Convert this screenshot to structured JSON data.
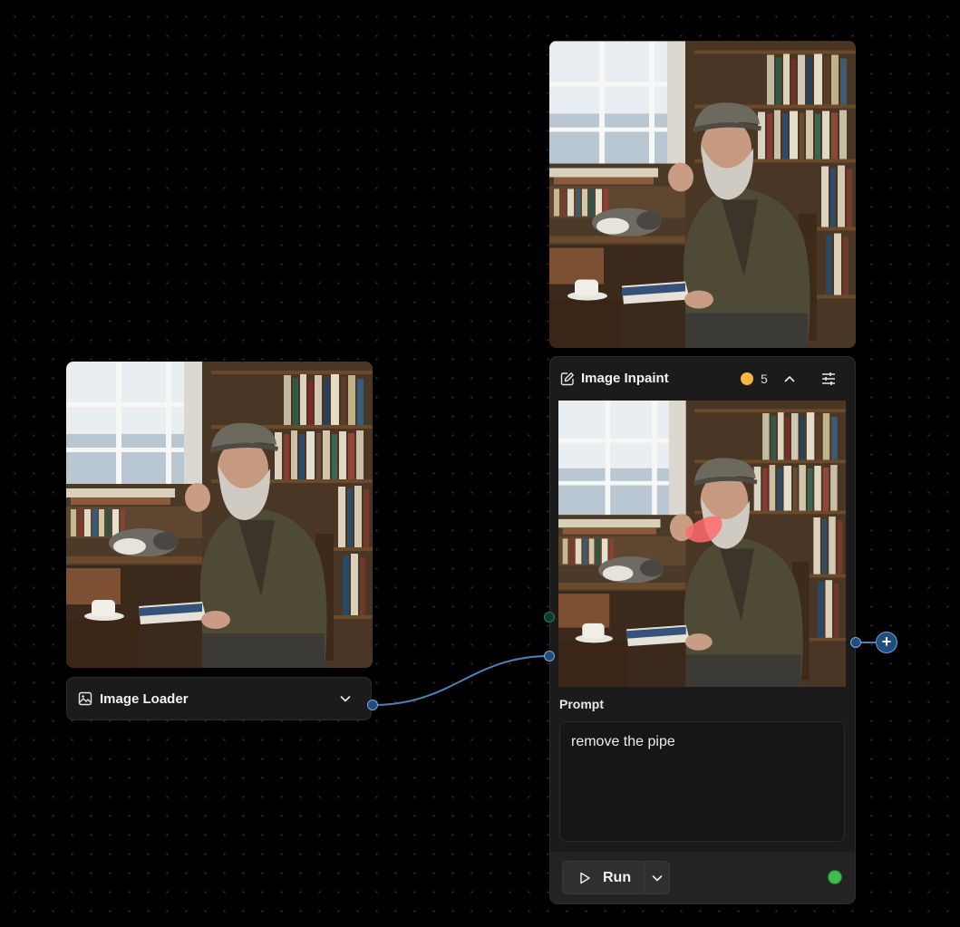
{
  "image_loader": {
    "title": "Image Loader",
    "icon": "image-icon",
    "dropdown_icon": "chevron-down-icon"
  },
  "image_inpaint": {
    "title": "Image Inpaint",
    "title_icon": "edit-icon",
    "cost": "5",
    "cost_icon": "coin-icon",
    "collapse_icon": "chevron-up-icon",
    "settings_icon": "sliders-icon",
    "prompt_label": "Prompt",
    "prompt_value": "remove the pipe",
    "run_label": "Run",
    "run_icon": "play-icon",
    "run_menu_icon": "chevron-down-icon",
    "status": "ready"
  },
  "colors": {
    "canvas_bg": "#000000",
    "node_bg": "#1b1b1b",
    "handle_blue": "#1f4e7e",
    "wire": "#4f82b8",
    "coin": "#f5b83d",
    "status_ok": "#3fbe4e",
    "pipe_inpaint_mask": "#ff6b6b"
  }
}
